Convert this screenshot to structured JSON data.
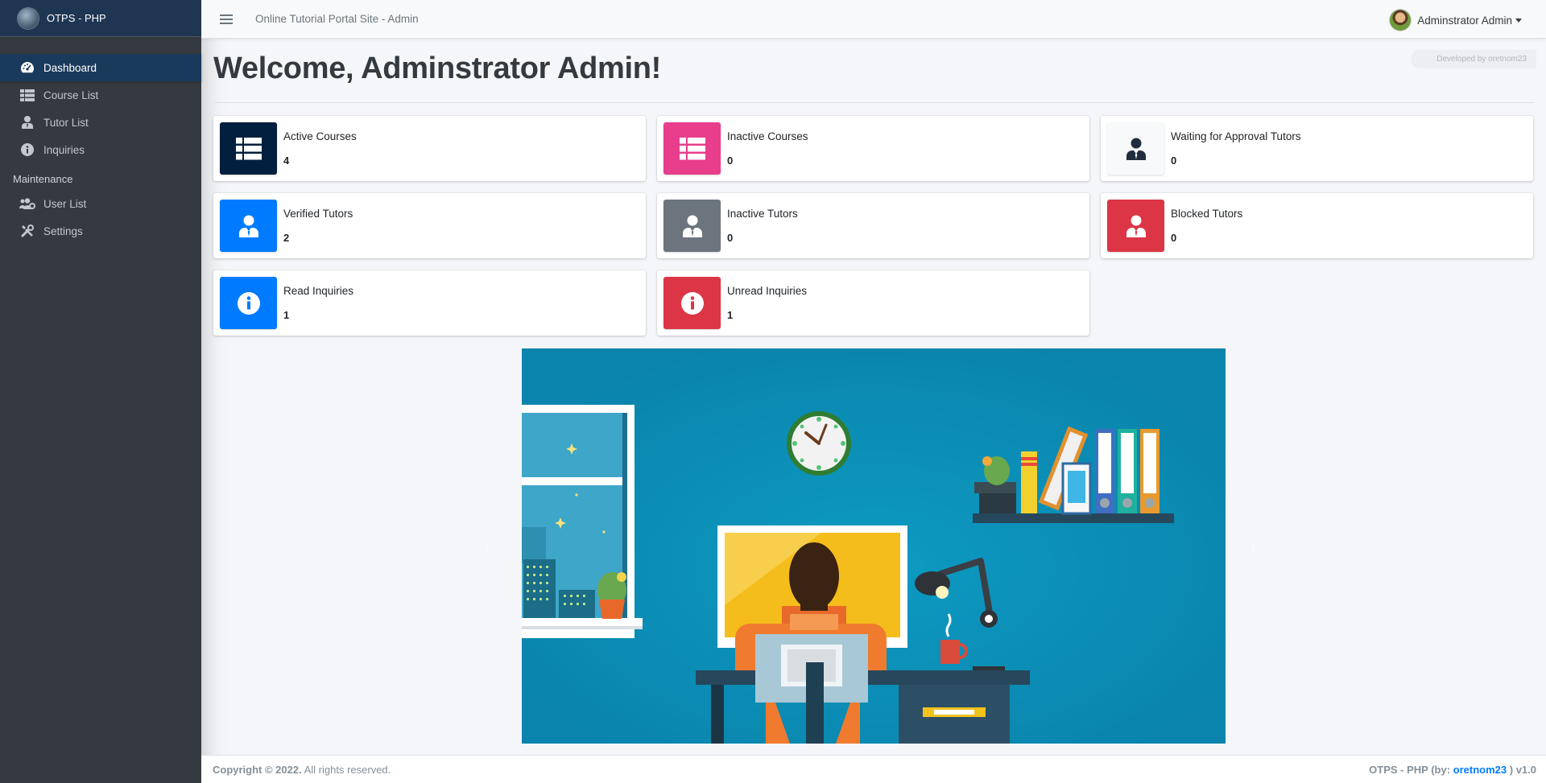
{
  "brand": {
    "name": "OTPS - PHP",
    "logo_icon": "globe-logo-icon"
  },
  "sidebar": {
    "items": [
      {
        "label": "Dashboard",
        "icon": "dashboard-icon",
        "active": true
      },
      {
        "label": "Course List",
        "icon": "table-icon"
      },
      {
        "label": "Tutor List",
        "icon": "user-tie-icon"
      },
      {
        "label": "Inquiries",
        "icon": "info-circle-icon"
      }
    ],
    "maintenance_header": "Maintenance",
    "maintenance_items": [
      {
        "label": "User List",
        "icon": "users-cog-icon"
      },
      {
        "label": "Settings",
        "icon": "tools-icon"
      }
    ]
  },
  "topbar": {
    "site_title": "Online Tutorial Portal Site - Admin",
    "user_name": "Adminstrator Admin"
  },
  "developer_badge": "Developed by oretnom23",
  "welcome": "Welcome, Adminstrator Admin!",
  "cards": [
    {
      "label": "Active Courses",
      "value": "4",
      "icon": "table-icon",
      "color": "#001f3f"
    },
    {
      "label": "Inactive Courses",
      "value": "0",
      "icon": "table-icon",
      "color": "#e83e8c"
    },
    {
      "label": "Waiting for Approval Tutors",
      "value": "0",
      "icon": "user-tie-icon",
      "color": "#f8f9fa"
    },
    {
      "label": "Verified Tutors",
      "value": "2",
      "icon": "user-tie-icon",
      "color": "#007bff"
    },
    {
      "label": "Inactive Tutors",
      "value": "0",
      "icon": "user-tie-icon",
      "color": "#6c757d"
    },
    {
      "label": "Blocked Tutors",
      "value": "0",
      "icon": "user-tie-icon",
      "color": "#dc3545"
    },
    {
      "label": "Read Inquiries",
      "value": "1",
      "icon": "info-circle-icon",
      "color": "#007bff"
    },
    {
      "label": "Unread Inquiries",
      "value": "1",
      "icon": "info-circle-icon",
      "color": "#dc3545"
    }
  ],
  "footer": {
    "copyright_bold": "Copyright © 2022.",
    "copyright_rest": " All rights reserved.",
    "right_prefix": "OTPS - PHP (by: ",
    "right_link": "oretnom23",
    "right_suffix": " ) v1.0"
  }
}
